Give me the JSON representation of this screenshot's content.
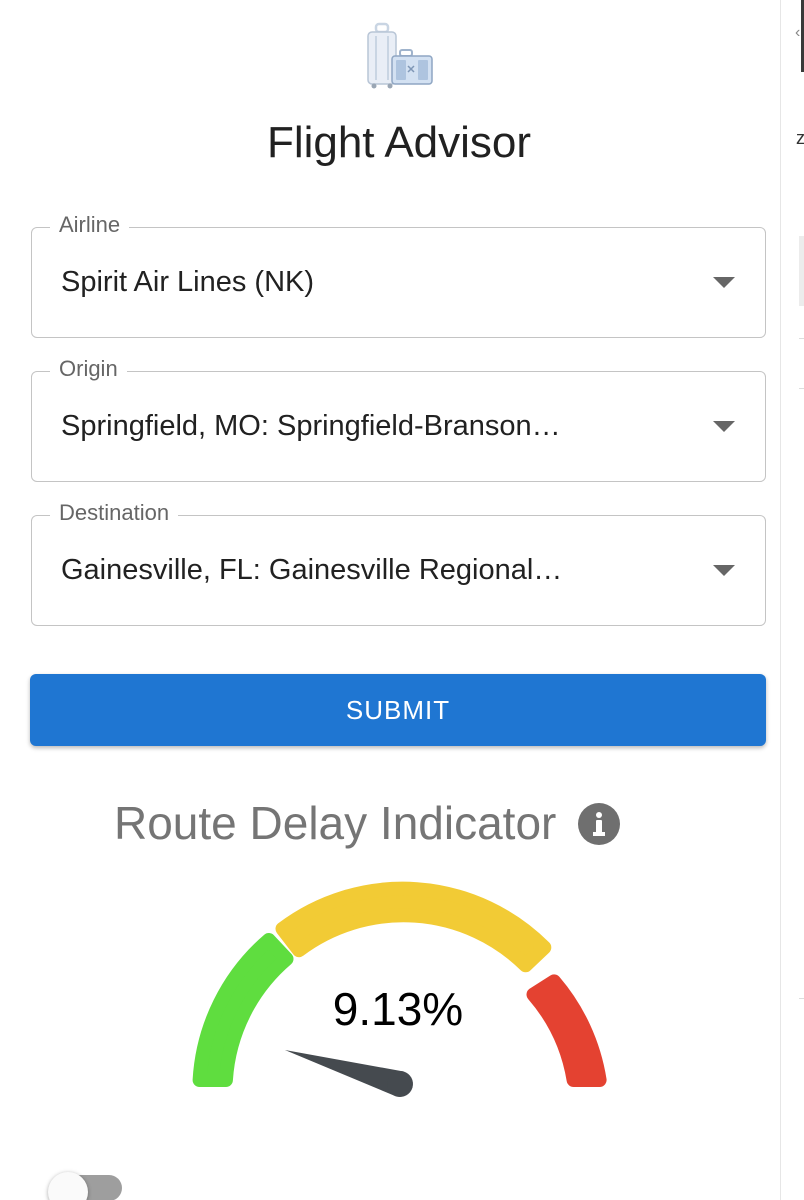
{
  "app": {
    "logo_icon": "luggage-icon",
    "title": "Flight Advisor"
  },
  "form": {
    "airline": {
      "label": "Airline",
      "value": "Spirit Air Lines (NK)"
    },
    "origin": {
      "label": "Origin",
      "value": "Springfield, MO: Springfield-Branson…"
    },
    "destination": {
      "label": "Destination",
      "value": "Gainesville, FL: Gainesville Regional…"
    },
    "submit_label": "SUBMIT"
  },
  "gauge": {
    "title": "Route Delay Indicator",
    "info_icon": "info-icon",
    "value_text": "9.13%",
    "value_percent": 9.13,
    "zones": [
      {
        "name": "low",
        "color": "#5fdd3f"
      },
      {
        "name": "medium",
        "color": "#f2cb35"
      },
      {
        "name": "high",
        "color": "#e44231"
      }
    ],
    "needle_color": "#454a4f"
  },
  "toggle": {
    "checked": false
  },
  "colors": {
    "primary": "#1f76d2",
    "label_gray": "#666666",
    "border_gray": "#c4c4c4"
  }
}
